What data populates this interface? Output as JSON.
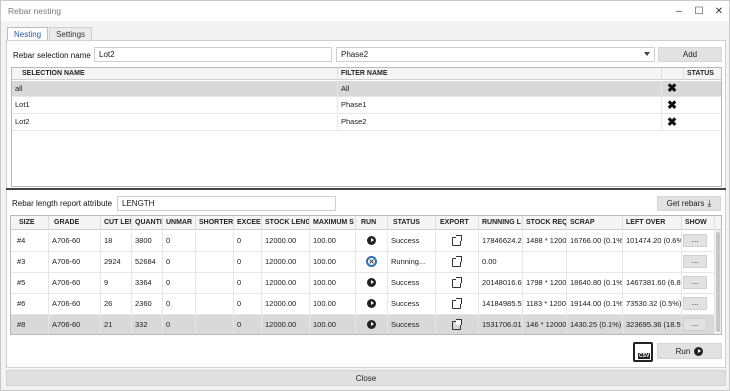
{
  "window": {
    "title": "Rebar nesting",
    "minimize_glyph": "–",
    "maximize_glyph": "☐",
    "close_glyph": "✕"
  },
  "tabs": [
    {
      "label": "Nesting",
      "active": true
    },
    {
      "label": "Settings",
      "active": false
    }
  ],
  "selection": {
    "name_label": "Rebar selection name",
    "name_value": "Lot2",
    "filter_value": "Phase2",
    "add_label": "Add"
  },
  "selection_table": {
    "columns": [
      "SELECTION NAME",
      "FILTER NAME",
      "",
      "STATUS"
    ],
    "rows": [
      {
        "name": "all",
        "filter": "All",
        "selected": true
      },
      {
        "name": "Lot1",
        "filter": "Phase1",
        "selected": false
      },
      {
        "name": "Lot2",
        "filter": "Phase2",
        "selected": false
      }
    ],
    "remove_glyph": "✖"
  },
  "report": {
    "attr_label": "Rebar length report attribute",
    "attr_value": "LENGTH",
    "get_rebars_label": "Get rebars",
    "download_glyph": "⤓"
  },
  "results_table": {
    "columns": [
      "SIZE",
      "GRADE",
      "CUT LEN",
      "QUANTI",
      "UNMAR",
      "SHORTER F",
      "EXCEED",
      "STOCK LENG",
      "MAXIMUM S",
      "RUN",
      "STATUS",
      "EXPORT",
      "RUNNING L",
      "STOCK REQ",
      "SCRAP",
      "LEFT OVER",
      "SHOW"
    ],
    "rows": [
      {
        "size": "#4",
        "grade": "A706-60",
        "cut": "18",
        "qty": "3800",
        "unmar": "0",
        "shorter": "",
        "exceed": "0",
        "stock": "12000.00",
        "max": "100.00",
        "run": "play",
        "status": "Success",
        "running": "17846624.20",
        "stockreq": "1488 * 1200(",
        "scrap": "16766.00 (0.1%)",
        "left": "101474.20 (0.6%)",
        "show": "...",
        "selected": false
      },
      {
        "size": "#3",
        "grade": "A706-60",
        "cut": "2924",
        "qty": "52684",
        "unmar": "0",
        "shorter": "",
        "exceed": "0",
        "stock": "12000.00",
        "max": "100.00",
        "run": "cancel",
        "status": "Running...",
        "running": "0.00",
        "stockreq": "",
        "scrap": "",
        "left": "",
        "show": "...",
        "selected": false
      },
      {
        "size": "#5",
        "grade": "A706-60",
        "cut": "9",
        "qty": "3364",
        "unmar": "0",
        "shorter": "",
        "exceed": "0",
        "stock": "12000.00",
        "max": "100.00",
        "run": "play",
        "status": "Success",
        "running": "20148016.60",
        "stockreq": "1798 * 1200(",
        "scrap": "18640.80 (0.1%)",
        "left": "1467381.60 (6.8%",
        "show": "...",
        "selected": false
      },
      {
        "size": "#6",
        "grade": "A706-60",
        "cut": "26",
        "qty": "2360",
        "unmar": "0",
        "shorter": "",
        "exceed": "0",
        "stock": "12000.00",
        "max": "100.00",
        "run": "play",
        "status": "Success",
        "running": "14184985.51",
        "stockreq": "1183 * 1200(",
        "scrap": "19144.00 (0.1%)",
        "left": "73530.32 (0.5%)",
        "show": "...",
        "selected": false
      },
      {
        "size": "#8",
        "grade": "A706-60",
        "cut": "21",
        "qty": "332",
        "unmar": "0",
        "shorter": "",
        "exceed": "0",
        "stock": "12000.00",
        "max": "100.00",
        "run": "play",
        "status": "Success",
        "running": "1531706.01",
        "stockreq": "146 * 12000",
        "scrap": "1430.25 (0.1%)",
        "left": "323695.36 (18.5%",
        "show": "...",
        "selected": true
      }
    ],
    "cancel_glyph": "✕"
  },
  "actions": {
    "csv_label": "CSV",
    "run_label": "Run",
    "close_label": "Close"
  }
}
